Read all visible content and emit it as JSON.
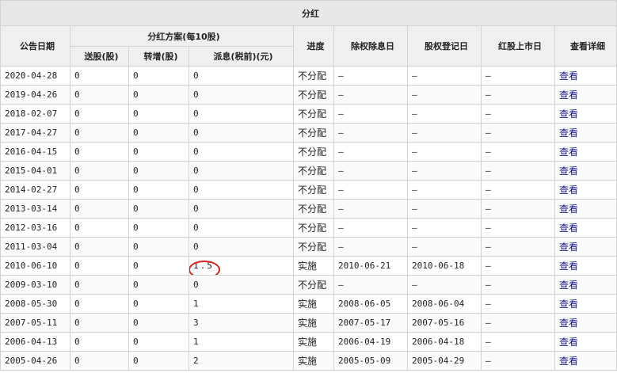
{
  "title": "分红",
  "headers": {
    "date": "公告日期",
    "plan_group": "分红方案(每10股)",
    "bonus_shares": "送股(股)",
    "transfer_shares": "转增(股)",
    "cash_dividend": "派息(税前)(元)",
    "progress": "进度",
    "ex_date": "除权除息日",
    "record_date": "股权登记日",
    "listing_date": "红股上市日",
    "details": "查看详细"
  },
  "rows": [
    {
      "date": "2020-04-28",
      "bonus": "0",
      "transfer": "0",
      "cash": "0",
      "progress": "不分配",
      "ex_date": "—",
      "record_date": "—",
      "listing_date": "—",
      "link": "查看"
    },
    {
      "date": "2019-04-26",
      "bonus": "0",
      "transfer": "0",
      "cash": "0",
      "progress": "不分配",
      "ex_date": "—",
      "record_date": "—",
      "listing_date": "—",
      "link": "查看"
    },
    {
      "date": "2018-02-07",
      "bonus": "0",
      "transfer": "0",
      "cash": "0",
      "progress": "不分配",
      "ex_date": "—",
      "record_date": "—",
      "listing_date": "—",
      "link": "查看"
    },
    {
      "date": "2017-04-27",
      "bonus": "0",
      "transfer": "0",
      "cash": "0",
      "progress": "不分配",
      "ex_date": "—",
      "record_date": "—",
      "listing_date": "—",
      "link": "查看"
    },
    {
      "date": "2016-04-15",
      "bonus": "0",
      "transfer": "0",
      "cash": "0",
      "progress": "不分配",
      "ex_date": "—",
      "record_date": "—",
      "listing_date": "—",
      "link": "查看"
    },
    {
      "date": "2015-04-01",
      "bonus": "0",
      "transfer": "0",
      "cash": "0",
      "progress": "不分配",
      "ex_date": "—",
      "record_date": "—",
      "listing_date": "—",
      "link": "查看"
    },
    {
      "date": "2014-02-27",
      "bonus": "0",
      "transfer": "0",
      "cash": "0",
      "progress": "不分配",
      "ex_date": "—",
      "record_date": "—",
      "listing_date": "—",
      "link": "查看"
    },
    {
      "date": "2013-03-14",
      "bonus": "0",
      "transfer": "0",
      "cash": "0",
      "progress": "不分配",
      "ex_date": "—",
      "record_date": "—",
      "listing_date": "—",
      "link": "查看"
    },
    {
      "date": "2012-03-16",
      "bonus": "0",
      "transfer": "0",
      "cash": "0",
      "progress": "不分配",
      "ex_date": "—",
      "record_date": "—",
      "listing_date": "—",
      "link": "查看"
    },
    {
      "date": "2011-03-04",
      "bonus": "0",
      "transfer": "0",
      "cash": "0",
      "progress": "不分配",
      "ex_date": "—",
      "record_date": "—",
      "listing_date": "—",
      "link": "查看"
    },
    {
      "date": "2010-06-10",
      "bonus": "0",
      "transfer": "0",
      "cash": "1.5",
      "progress": "实施",
      "ex_date": "2010-06-21",
      "record_date": "2010-06-18",
      "listing_date": "—",
      "link": "查看",
      "highlight": true
    },
    {
      "date": "2009-03-10",
      "bonus": "0",
      "transfer": "0",
      "cash": "0",
      "progress": "不分配",
      "ex_date": "—",
      "record_date": "—",
      "listing_date": "—",
      "link": "查看"
    },
    {
      "date": "2008-05-30",
      "bonus": "0",
      "transfer": "0",
      "cash": "1",
      "progress": "实施",
      "ex_date": "2008-06-05",
      "record_date": "2008-06-04",
      "listing_date": "—",
      "link": "查看"
    },
    {
      "date": "2007-05-11",
      "bonus": "0",
      "transfer": "0",
      "cash": "3",
      "progress": "实施",
      "ex_date": "2007-05-17",
      "record_date": "2007-05-16",
      "listing_date": "—",
      "link": "查看"
    },
    {
      "date": "2006-04-13",
      "bonus": "0",
      "transfer": "0",
      "cash": "1",
      "progress": "实施",
      "ex_date": "2006-04-19",
      "record_date": "2006-04-18",
      "listing_date": "—",
      "link": "查看"
    },
    {
      "date": "2005-04-26",
      "bonus": "0",
      "transfer": "0",
      "cash": "2",
      "progress": "实施",
      "ex_date": "2005-05-09",
      "record_date": "2005-04-29",
      "listing_date": "—",
      "link": "查看"
    }
  ],
  "colors": {
    "highlight_ring": "#e02020",
    "link": "#1a1a8c"
  }
}
